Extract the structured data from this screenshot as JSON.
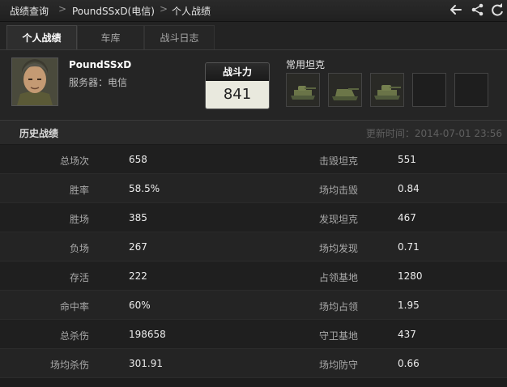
{
  "breadcrumb": {
    "items": [
      "战绩查询",
      "PoundSSxD(电信)",
      "个人战绩"
    ],
    "separator": ">"
  },
  "header_icons": [
    "back-arrow-icon",
    "share-icon",
    "refresh-icon"
  ],
  "tabs": [
    {
      "label": "个人战绩",
      "active": true
    },
    {
      "label": "车库",
      "active": false
    },
    {
      "label": "战斗日志",
      "active": false
    }
  ],
  "profile": {
    "name": "PoundSSxD",
    "server": "服务器：电信",
    "power_label": "战斗力",
    "power_value": "841",
    "fav_tanks_label": "常用坦克"
  },
  "history": {
    "title": "历史战绩",
    "update_time": "更新时间：2014-07-01 23:56",
    "rows": [
      {
        "l_label": "总场次",
        "l_value": "658",
        "r_label": "击毁坦克",
        "r_value": "551"
      },
      {
        "l_label": "胜率",
        "l_value": "58.5%",
        "r_label": "场均击毁",
        "r_value": "0.84"
      },
      {
        "l_label": "胜场",
        "l_value": "385",
        "r_label": "发现坦克",
        "r_value": "467"
      },
      {
        "l_label": "负场",
        "l_value": "267",
        "r_label": "场均发现",
        "r_value": "0.71"
      },
      {
        "l_label": "存活",
        "l_value": "222",
        "r_label": "占领基地",
        "r_value": "1280"
      },
      {
        "l_label": "命中率",
        "l_value": "60%",
        "r_label": "场均占领",
        "r_value": "1.95"
      },
      {
        "l_label": "总杀伤",
        "l_value": "198658",
        "r_label": "守卫基地",
        "r_value": "437"
      },
      {
        "l_label": "场均杀伤",
        "l_value": "301.91",
        "r_label": "场均防守",
        "r_value": "0.66"
      }
    ]
  },
  "colors": {
    "background": "#1d1d1d",
    "active_tab_text": "#ffffff",
    "power_box": "#e9e9de",
    "label_text": "#a9a9a9",
    "value_text": "#ececec"
  }
}
